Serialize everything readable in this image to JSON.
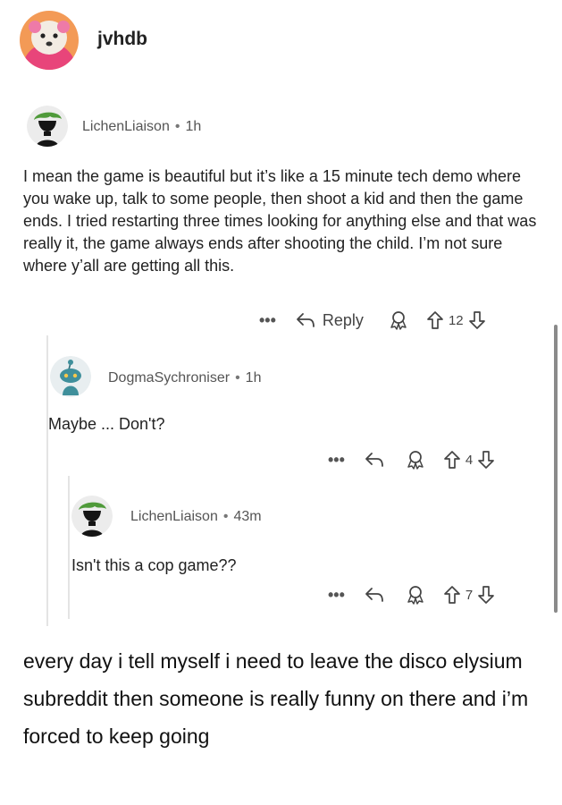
{
  "post": {
    "username": "jvhdb",
    "caption": "every day i tell myself i need to leave the disco elysium subreddit then someone is really funny on there and i’m forced to keep going"
  },
  "comments": [
    {
      "author": "LichenLiaison",
      "time": "1h",
      "body": "I mean the game is beautiful but it’s like a 15 minute tech demo where you wake up, talk to some people, then shoot a kid and then the game ends. I tried restarting three times looking for anything else and that was really it, the game always ends after shooting the child. I’m not sure where y’all are getting all this.",
      "actions": {
        "more": "•••",
        "reply": "Reply",
        "votes": "12"
      }
    },
    {
      "author": "DogmaSychroniser",
      "time": "1h",
      "body": "Maybe ... Don't?",
      "actions": {
        "more": "•••",
        "votes": "4"
      }
    },
    {
      "author": "LichenLiaison",
      "time": "43m",
      "body": "Isn't this a cop game??",
      "actions": {
        "more": "•••",
        "votes": "7"
      }
    }
  ],
  "meta": {
    "separator": "•"
  },
  "icons": [
    "reply-arrow-icon",
    "award-icon",
    "upvote-arrow-icon",
    "downvote-arrow-icon",
    "more-dots-icon"
  ],
  "colors": {
    "accent": "#444444",
    "snoo_teal": "#3f8f9b",
    "moss_green": "#4f9a3a"
  }
}
